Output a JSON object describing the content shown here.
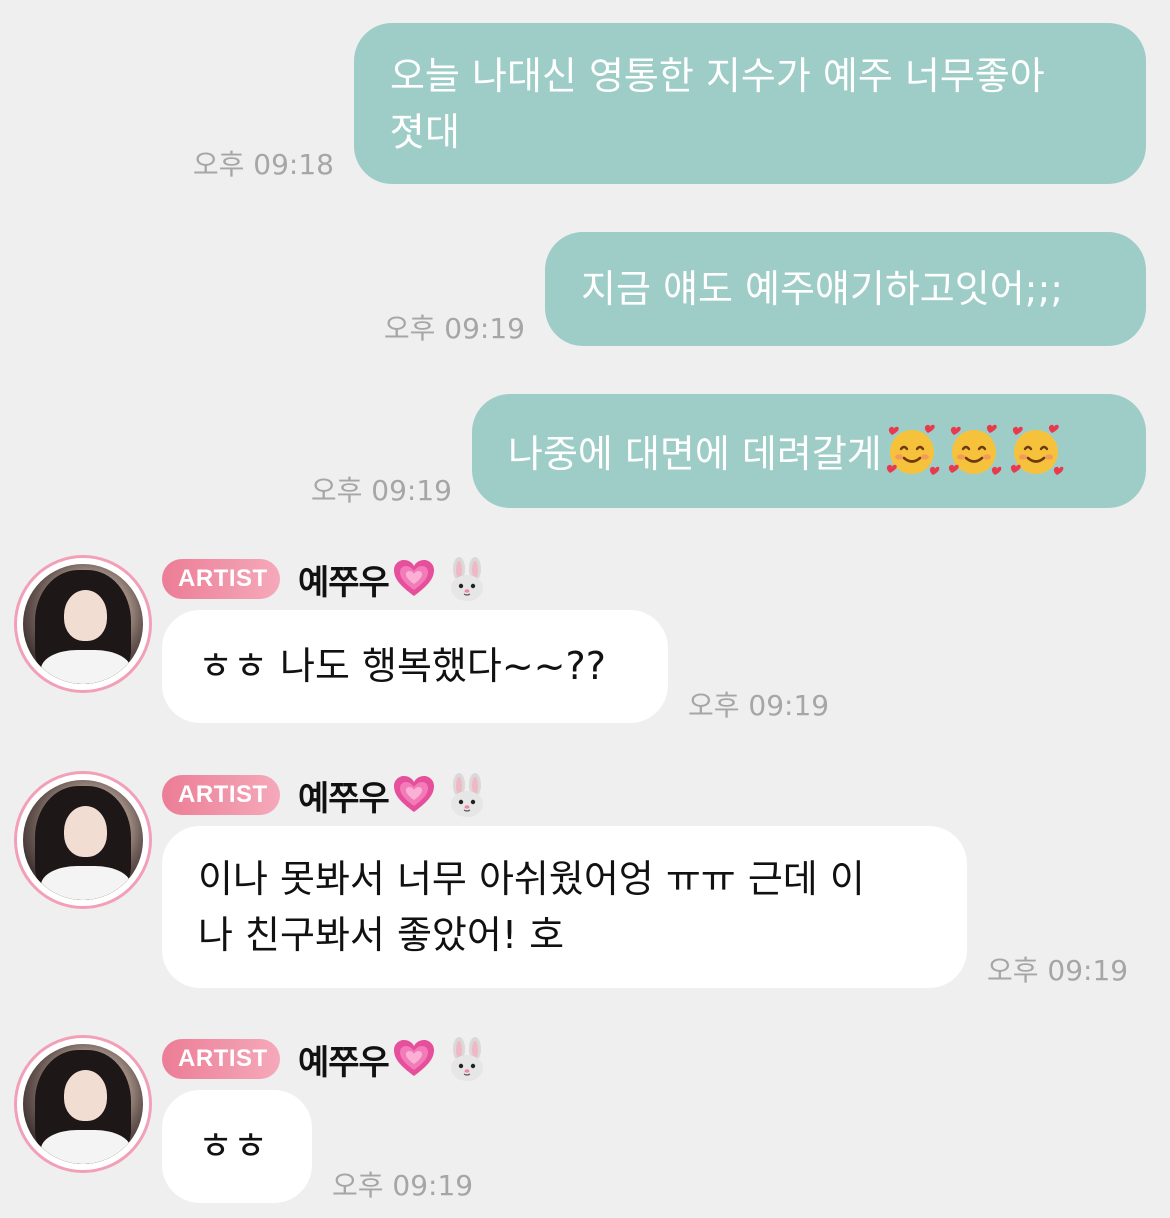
{
  "colors": {
    "background": "#efefef",
    "sent_bubble": "#9ecdc8",
    "received_bubble": "#ffffff",
    "badge_gradient_start": "#ec7d96",
    "badge_gradient_end": "#f5a9ba",
    "avatar_ring": "#f1a0b8",
    "timestamp": "#a6a6a6"
  },
  "sent_messages": [
    {
      "text_line1": "오늘 나대신 영통한 지수가 예주 너무좋아",
      "text_line2": "졋대",
      "time": "오후 09:18"
    },
    {
      "text": "지금 얘도 예주얘기하고잇어;;;",
      "time": "오후 09:19"
    },
    {
      "text": "나중에 대면에 데려갈게",
      "emojis": [
        "smiling-face-with-hearts-icon",
        "smiling-face-with-hearts-icon",
        "smiling-face-with-hearts-icon"
      ],
      "time": "오후 09:19"
    }
  ],
  "received_messages": [
    {
      "badge": "ARTIST",
      "sender": "예쭈우",
      "name_icons": [
        "growing-heart-icon",
        "rabbit-face-icon"
      ],
      "text": "ㅎㅎ 나도 행복했다~~??",
      "time": "오후 09:19"
    },
    {
      "badge": "ARTIST",
      "sender": "예쭈우",
      "name_icons": [
        "growing-heart-icon",
        "rabbit-face-icon"
      ],
      "text_line1": "이나 못봐서 너무 아쉬웠어엉 ㅠㅠ 근데 이",
      "text_line2": "나 친구봐서 좋았어! 호",
      "time": "오후 09:19"
    },
    {
      "badge": "ARTIST",
      "sender": "예쭈우",
      "name_icons": [
        "growing-heart-icon",
        "rabbit-face-icon"
      ],
      "text": "ㅎㅎ",
      "time": "오후 09:19"
    }
  ]
}
